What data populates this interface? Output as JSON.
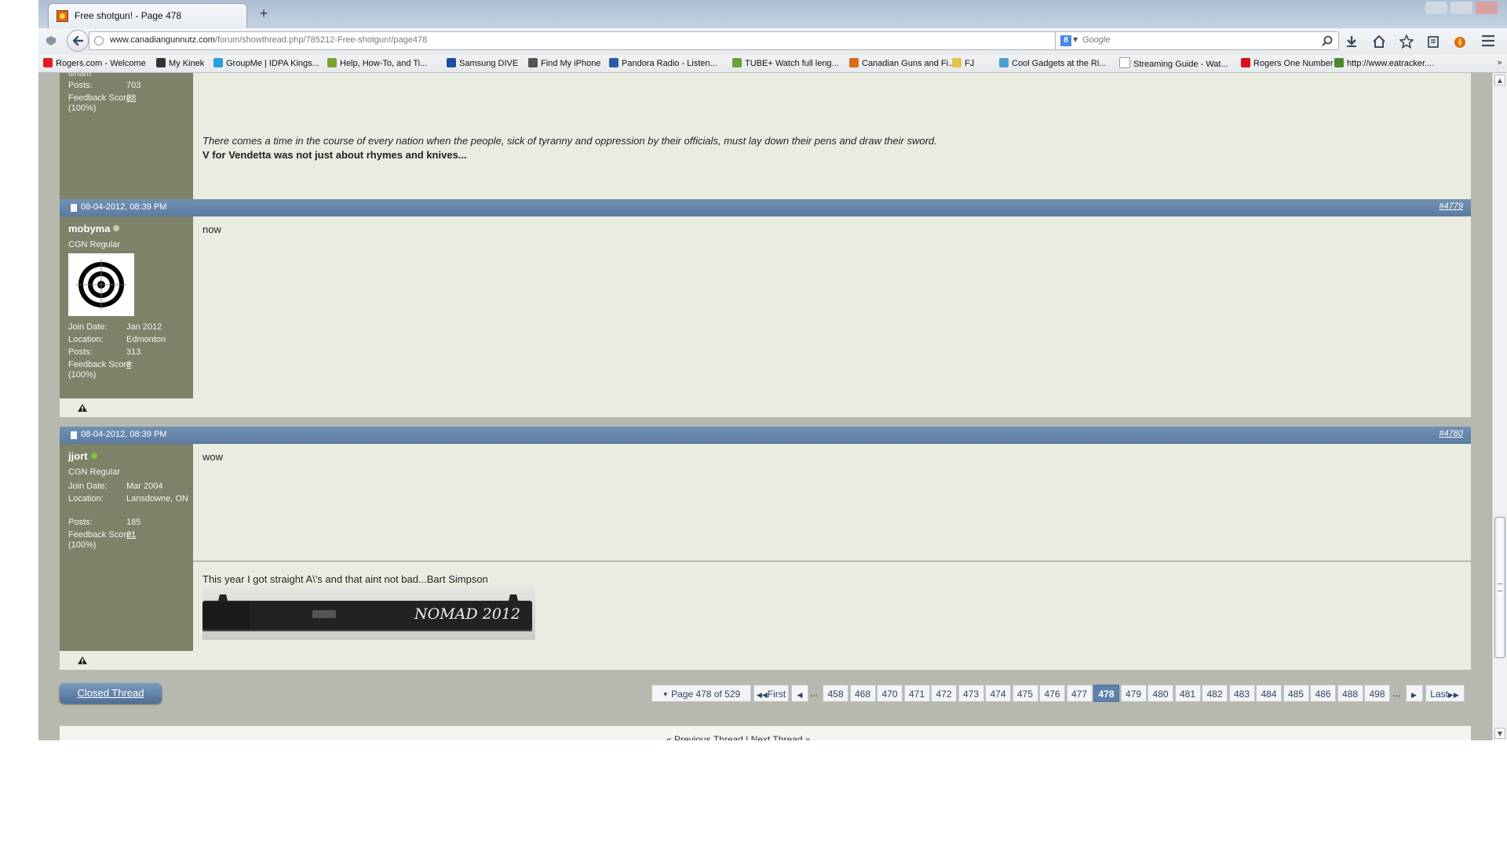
{
  "tab": {
    "title": "Free shotgun! - Page 478",
    "new_tab": "+"
  },
  "nav": {
    "url_host": "www.canadiangunnutz.com",
    "url_path": "/forum/showthread.php/785212-Free-shotgun!/page478",
    "search_placeholder": "Google",
    "search_engine_letter": "8"
  },
  "bookmarks": [
    {
      "label": "Rogers.com - Welcome",
      "color": "#e21b23"
    },
    {
      "label": "My Kinek",
      "color": "#333333"
    },
    {
      "label": "GroupMe | IDPA Kings...",
      "color": "#2a9fd8"
    },
    {
      "label": "Help, How-To, and Ti...",
      "color": "#7aa32b"
    },
    {
      "label": "Samsung DIVE",
      "color": "#1b4ea0"
    },
    {
      "label": "Find My iPhone",
      "color": "#555555"
    },
    {
      "label": "Pandora Radio - Listen...",
      "color": "#2a5aa8"
    },
    {
      "label": "TUBE+ Watch full leng...",
      "color": "#6aa23a"
    },
    {
      "label": "Canadian Guns and Fi...",
      "color": "#d86a1a"
    },
    {
      "label": "FJ",
      "color": "#e5c34a"
    },
    {
      "label": "Cool Gadgets at the Ri...",
      "color": "#4aa0d0"
    },
    {
      "label": "Streaming Guide - Wat...",
      "color": "#ffffff"
    },
    {
      "label": "Rogers One Number",
      "color": "#d8101a"
    },
    {
      "label": "http://www.eatracker....",
      "color": "#4a8a2a"
    }
  ],
  "bookmarks_more": "»",
  "post_prev": {
    "side_top_name_partial": "tilham",
    "posts_label": "Posts:",
    "posts_value": "703",
    "feedback_label": "Feedback Score:",
    "feedback_value": "28",
    "feedback_pct": "(100%)",
    "sig_line1": "There comes a time in the course of every nation when the people, sick of tyranny and oppression by their officials, must lay down their pens and draw their sword.",
    "sig_line2": "V for Vendetta was not just about rhymes and knives..."
  },
  "post_4779": {
    "date": "08-04-2012, 08:39 PM",
    "number": "#4779",
    "username": "mobyma",
    "user_title": "CGN Regular",
    "join_label": "Join Date:",
    "join_value": "Jan 2012",
    "location_label": "Location:",
    "location_value": "Edmonton",
    "posts_label": "Posts:",
    "posts_value": "313",
    "feedback_label": "Feedback Score:",
    "feedback_value": "3",
    "feedback_pct": "(100%)",
    "message": "now"
  },
  "post_4780": {
    "date": "08-04-2012, 08:39 PM",
    "number": "#4780",
    "username": "jjort",
    "user_title": "CGN Regular",
    "join_label": "Join Date:",
    "join_value": "Mar 2004",
    "location_label": "Location:",
    "location_value": "Lansdowne, ON",
    "posts_label": "Posts:",
    "posts_value": "185",
    "feedback_label": "Feedback Score:",
    "feedback_value": "21",
    "feedback_pct": "(100%)",
    "message": "wow",
    "signature": "This year I got straight A\\'s and that aint not bad...Bart Simpson",
    "sig_image_text": "NOMAD 2012"
  },
  "thread_controls": {
    "closed_button": "Closed Thread",
    "page_info": "Page 478 of 529",
    "first": "First",
    "last": "Last",
    "ellipsis": "...",
    "pages": [
      "458",
      "468",
      "470",
      "471",
      "472",
      "473",
      "474",
      "475",
      "476",
      "477",
      "478",
      "479",
      "480",
      "481",
      "482",
      "483",
      "484",
      "485",
      "486",
      "488",
      "498"
    ],
    "current_page": "478",
    "prev_next": "« Previous Thread | Next Thread »"
  },
  "colors": {
    "post_header": "#5f7fa6",
    "user_panel": "#7d8369",
    "post_body": "#e9ede0",
    "page_bg": "#b7b8ae",
    "online": "#7fbf4a",
    "offline": "#c9c9b0"
  }
}
